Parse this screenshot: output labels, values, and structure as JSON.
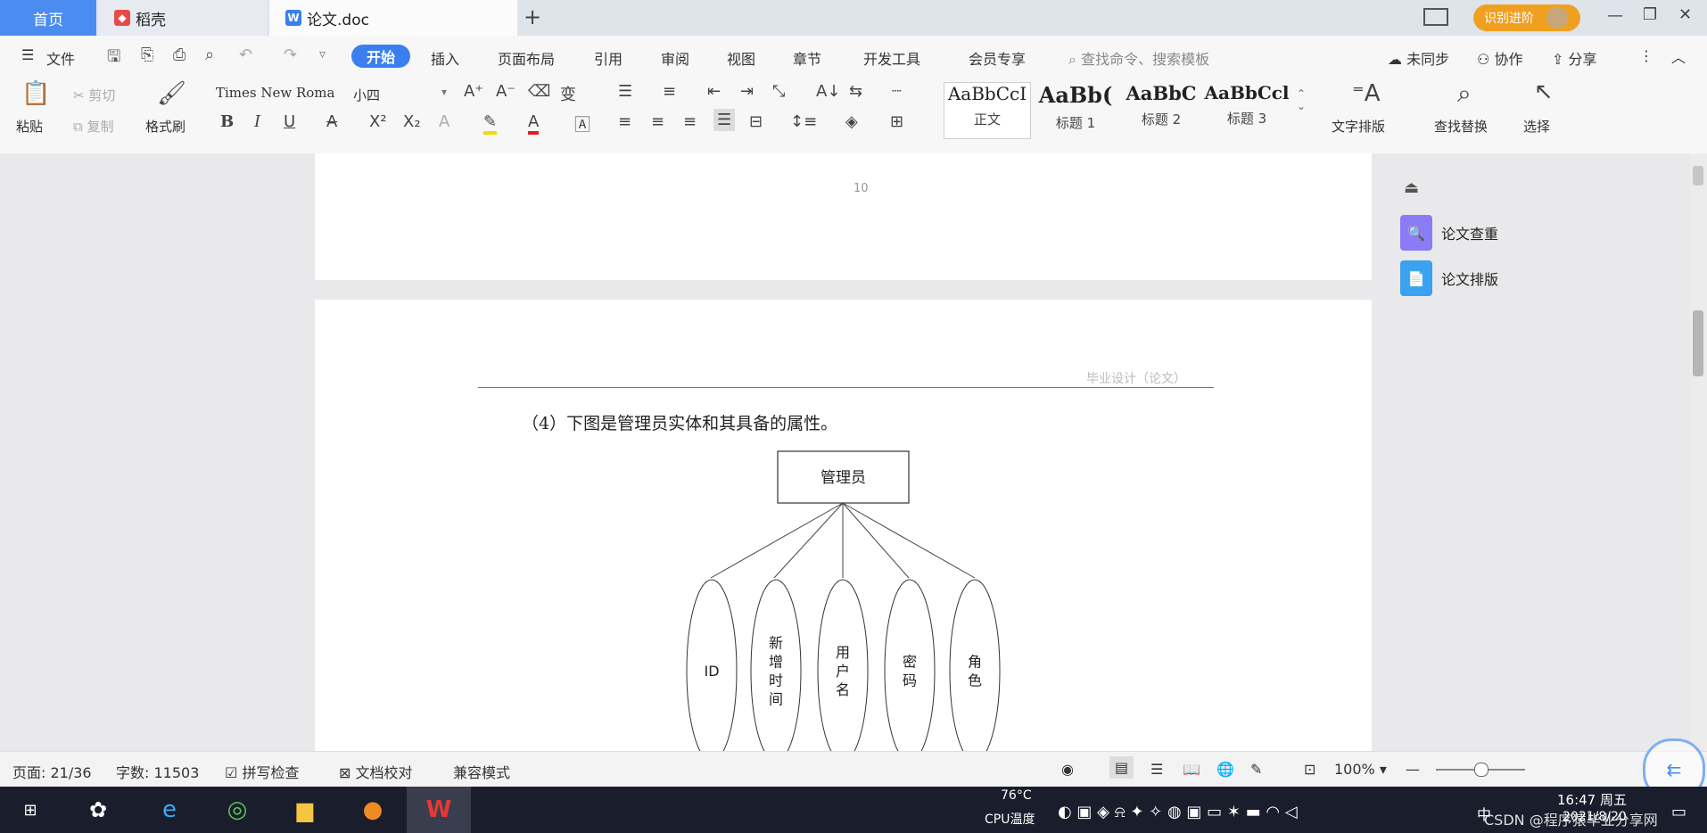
{
  "tabs": {
    "home": "首页",
    "daoke": "稻壳",
    "doc": "论文.doc",
    "new_tab": "+"
  },
  "titlebar": {
    "promo": "识别进阶",
    "minimize": "—",
    "restore": "❐",
    "close": "✕"
  },
  "menu": {
    "file": "文件",
    "items": [
      "开始",
      "插入",
      "页面布局",
      "引用",
      "审阅",
      "视图",
      "章节",
      "开发工具",
      "会员专享"
    ],
    "search_placeholder": "查找命令、搜索模板",
    "sync": "未同步",
    "collab": "协作",
    "share": "分享",
    "more": "⋮"
  },
  "ribbon": {
    "paste": "粘贴",
    "cut": "剪切",
    "copy": "复制",
    "format_painter": "格式刷",
    "font_name": "Times New Roma",
    "font_size": "小四",
    "styles": [
      {
        "sample": "AaBbCcI",
        "label": "正文"
      },
      {
        "sample": "AaBb(",
        "label": "标题 1"
      },
      {
        "sample": "AaBbC",
        "label": "标题 2"
      },
      {
        "sample": "AaBbCcl",
        "label": "标题 3"
      }
    ],
    "text_layout": "文字排版",
    "find_replace": "查找替换",
    "select": "选择"
  },
  "document": {
    "page_number": "10",
    "header_text": "毕业设计（论文）",
    "paragraph": "（4）下图是管理员实体和其具备的属性。",
    "diagram": {
      "entity": "管理员",
      "attributes": [
        "ID",
        "新增时间",
        "用户名",
        "密码",
        "角色"
      ]
    }
  },
  "side_panel": {
    "check": "论文查重",
    "layout": "论文排版"
  },
  "status": {
    "page": "页面: 21/36",
    "words": "字数: 11503",
    "spell": "拼写检查",
    "proof": "文档校对",
    "compat": "兼容模式",
    "zoom": "100%",
    "zoom_level": 0.5
  },
  "taskbar": {
    "cpu": "CPU温度",
    "temp": "76°C",
    "time": "16:47 周五",
    "date": "2021/8/20",
    "watermark": "CSDN @程序猿毕业分享网"
  },
  "colors": {
    "accent": "#3a7ff0",
    "tab_active": "#4a8cf0",
    "taskbar": "#1a1d2b",
    "check_icon": "#8b7cf6",
    "layout_icon": "#3ca1ee"
  }
}
